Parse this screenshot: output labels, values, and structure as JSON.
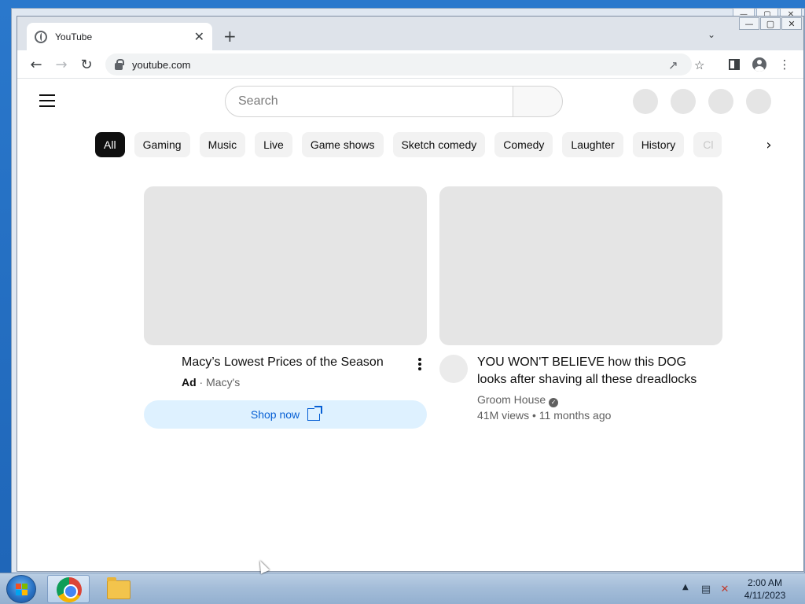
{
  "browser": {
    "tab_title": "YouTube",
    "tab_close": "✕",
    "new_tab": "+",
    "tab_search": "⌄",
    "url": "youtube.com",
    "window_controls": [
      "—",
      "▢",
      "✕"
    ]
  },
  "youtube": {
    "search_placeholder": "Search",
    "chips": [
      "All",
      "Gaming",
      "Music",
      "Live",
      "Game shows",
      "Sketch comedy",
      "Comedy",
      "Laughter",
      "History",
      "Cl"
    ],
    "chip_next": "›",
    "videos": [
      {
        "title": "Macy’s Lowest Prices of the Season",
        "ad_label": "Ad",
        "separator": " · ",
        "advertiser": "Macy's",
        "cta": "Shop now"
      },
      {
        "title_line1": "YOU WON'T BELIEVE how this DOG",
        "title_line2": "looks after shaving all these dreadlocks",
        "channel": "Groom House",
        "verified_mark": "✓",
        "stats": "41M views • 11 months ago"
      }
    ]
  },
  "taskbar": {
    "time": "2:00 AM",
    "date": "4/11/2023",
    "tray_arrow": "▲"
  },
  "icons": {
    "back": "back-arrow-icon",
    "forward": "forward-arrow-icon",
    "reload": "reload-icon",
    "share": "share-icon",
    "star": "bookmark-star-icon",
    "menu": "kebab-menu-icon"
  }
}
